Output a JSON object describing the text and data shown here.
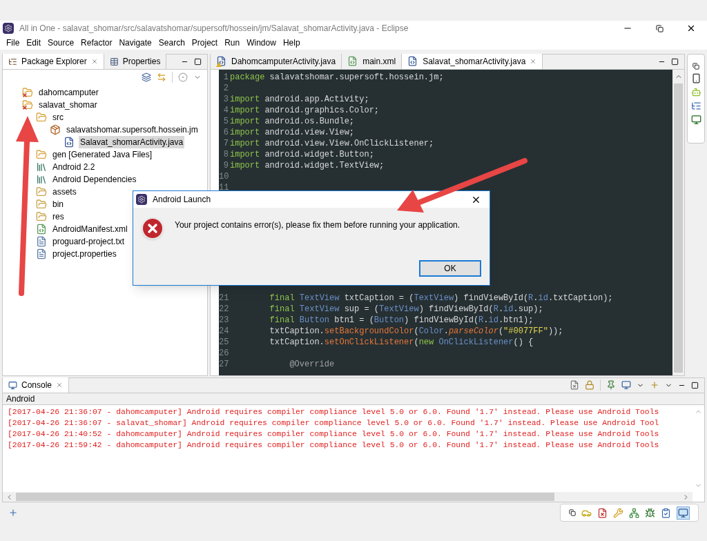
{
  "window": {
    "title": "All in One - salavat_shomar/src/salavatshomar/supersoft/hossein/jm/Salavat_shomarActivity.java - Eclipse"
  },
  "menu": [
    "File",
    "Edit",
    "Source",
    "Refactor",
    "Navigate",
    "Search",
    "Project",
    "Run",
    "Window",
    "Help"
  ],
  "left_panel": {
    "tabs": [
      {
        "label": "Package Explorer",
        "selected": true
      },
      {
        "label": "Properties",
        "selected": false
      }
    ],
    "tree": [
      {
        "label": "dahomcamputer",
        "kind": "project",
        "selected": false
      },
      {
        "label": "salavat_shomar",
        "kind": "project",
        "selected": false,
        "children": [
          {
            "label": "src",
            "kind": "source",
            "selected": false,
            "children": [
              {
                "label": "salavatshomar.supersoft.hossein.jm",
                "kind": "package",
                "selected": false,
                "children": [
                  {
                    "label": "Salavat_shomarActivity.java",
                    "kind": "java",
                    "selected": true
                  }
                ]
              }
            ]
          },
          {
            "label": "gen [Generated Java Files]",
            "kind": "source",
            "selected": false
          },
          {
            "label": "Android 2.2",
            "kind": "library",
            "selected": false
          },
          {
            "label": "Android Dependencies",
            "kind": "library",
            "selected": false
          },
          {
            "label": "assets",
            "kind": "folder",
            "selected": false
          },
          {
            "label": "bin",
            "kind": "folder",
            "selected": false
          },
          {
            "label": "res",
            "kind": "folder",
            "selected": false
          },
          {
            "label": "AndroidManifest.xml",
            "kind": "xml",
            "selected": false
          },
          {
            "label": "proguard-project.txt",
            "kind": "text",
            "selected": false
          },
          {
            "label": "project.properties",
            "kind": "text",
            "selected": false
          }
        ]
      }
    ]
  },
  "editor": {
    "tabs": [
      {
        "label": "DahomcamputerActivity.java",
        "kind": "java-warning",
        "selected": false
      },
      {
        "label": "main.xml",
        "kind": "xml",
        "selected": false
      },
      {
        "label": "Salavat_shomarActivity.java",
        "kind": "java",
        "selected": true
      }
    ],
    "lines_above": [
      {
        "number": "1",
        "tokens": [
          {
            "kind": "keyword",
            "text": "package"
          },
          {
            "kind": "plain",
            "text": " salavatshomar.supersoft.hossein.jm;"
          }
        ]
      },
      {
        "number": "2"
      },
      {
        "number": "3",
        "tokens": [
          {
            "kind": "keyword",
            "text": "import"
          },
          {
            "kind": "plain",
            "text": " android.app.Activity;"
          }
        ]
      },
      {
        "number": "4",
        "tokens": [
          {
            "kind": "keyword",
            "text": "import"
          },
          {
            "kind": "plain",
            "text": " android.graphics.Color;"
          }
        ]
      },
      {
        "number": "5",
        "tokens": [
          {
            "kind": "keyword",
            "text": "import"
          },
          {
            "kind": "plain",
            "text": " android.os.Bundle;"
          }
        ]
      },
      {
        "number": "6",
        "tokens": [
          {
            "kind": "keyword",
            "text": "import"
          },
          {
            "kind": "plain",
            "text": " android.view.View;"
          }
        ]
      },
      {
        "number": "7",
        "tokens": [
          {
            "kind": "keyword",
            "text": "import"
          },
          {
            "kind": "plain",
            "text": " android.view.View.OnClickListener;"
          }
        ]
      },
      {
        "number": "8",
        "tokens": [
          {
            "kind": "keyword",
            "text": "import"
          },
          {
            "kind": "plain",
            "text": " android.widget.Button;"
          }
        ]
      },
      {
        "number": "9",
        "tokens": [
          {
            "kind": "keyword",
            "text": "import"
          },
          {
            "kind": "plain",
            "text": " android.widget.TextView;"
          }
        ]
      },
      {
        "number": "10"
      },
      {
        "number": "11"
      }
    ],
    "lines_below": [
      {
        "number": "21",
        "tokens": [
          {
            "kind": "keyword",
            "text": "        final"
          },
          {
            "kind": "type",
            "text": " TextView"
          },
          {
            "kind": "plain",
            "text": " txtCaption = ("
          },
          {
            "kind": "type",
            "text": "TextView"
          },
          {
            "kind": "plain",
            "text": ") findViewById("
          },
          {
            "kind": "type",
            "text": "R"
          },
          {
            "kind": "plain",
            "text": "."
          },
          {
            "kind": "type",
            "text": "id"
          },
          {
            "kind": "plain",
            "text": ".txtCaption);"
          }
        ]
      },
      {
        "number": "22",
        "tokens": [
          {
            "kind": "keyword",
            "text": "        final"
          },
          {
            "kind": "type",
            "text": " TextView"
          },
          {
            "kind": "plain",
            "text": " sup = ("
          },
          {
            "kind": "type",
            "text": "TextView"
          },
          {
            "kind": "plain",
            "text": ") findViewById("
          },
          {
            "kind": "type",
            "text": "R"
          },
          {
            "kind": "plain",
            "text": "."
          },
          {
            "kind": "type",
            "text": "id"
          },
          {
            "kind": "plain",
            "text": ".sup);"
          }
        ]
      },
      {
        "number": "23",
        "tokens": [
          {
            "kind": "keyword",
            "text": "        final"
          },
          {
            "kind": "type",
            "text": " Button"
          },
          {
            "kind": "plain",
            "text": " btn1 = ("
          },
          {
            "kind": "type",
            "text": "Button"
          },
          {
            "kind": "plain",
            "text": ") findViewById("
          },
          {
            "kind": "type",
            "text": "R"
          },
          {
            "kind": "plain",
            "text": "."
          },
          {
            "kind": "type",
            "text": "id"
          },
          {
            "kind": "plain",
            "text": ".btn1);"
          }
        ]
      },
      {
        "number": "24",
        "tokens": [
          {
            "kind": "plain",
            "text": "        txtCaption."
          },
          {
            "kind": "method",
            "text": "setBackgroundColor"
          },
          {
            "kind": "plain",
            "text": "("
          },
          {
            "kind": "type",
            "text": "Color"
          },
          {
            "kind": "plain",
            "text": "."
          },
          {
            "kind": "static",
            "text": "parseColor"
          },
          {
            "kind": "plain",
            "text": "("
          },
          {
            "kind": "string",
            "text": "\"#0077FF\""
          },
          {
            "kind": "plain",
            "text": "));"
          }
        ]
      },
      {
        "number": "25",
        "tokens": [
          {
            "kind": "plain",
            "text": "        txtCaption."
          },
          {
            "kind": "method",
            "text": "setOnClickListener"
          },
          {
            "kind": "plain",
            "text": "("
          },
          {
            "kind": "keyword",
            "text": "new"
          },
          {
            "kind": "type",
            "text": " OnClickListener"
          },
          {
            "kind": "plain",
            "text": "() {"
          }
        ]
      },
      {
        "number": "26"
      },
      {
        "number": "27",
        "tokens": [
          {
            "kind": "annotation",
            "text": "            @Override"
          }
        ]
      }
    ]
  },
  "console": {
    "tab": "Console",
    "source": "Android",
    "lines": [
      "[2017-04-26 21:36:07 - dahomcamputer] Android requires compiler compliance level 5.0 or 6.0. Found '1.7' instead. Please use Android Tools",
      "[2017-04-26 21:36:07 - salavat_shomar] Android requires compiler compliance level 5.0 or 6.0. Found '1.7' instead. Please use Android Tool",
      "[2017-04-26 21:40:52 - dahomcamputer] Android requires compiler compliance level 5.0 or 6.0. Found '1.7' instead. Please use Android Tools",
      "[2017-04-26 21:59:42 - dahomcamputer] Android requires compiler compliance level 5.0 or 6.0. Found '1.7' instead. Please use Android Tools"
    ]
  },
  "dialog": {
    "title": "Android Launch",
    "message": "Your project contains error(s), please fix them before running your application.",
    "button": "OK"
  }
}
